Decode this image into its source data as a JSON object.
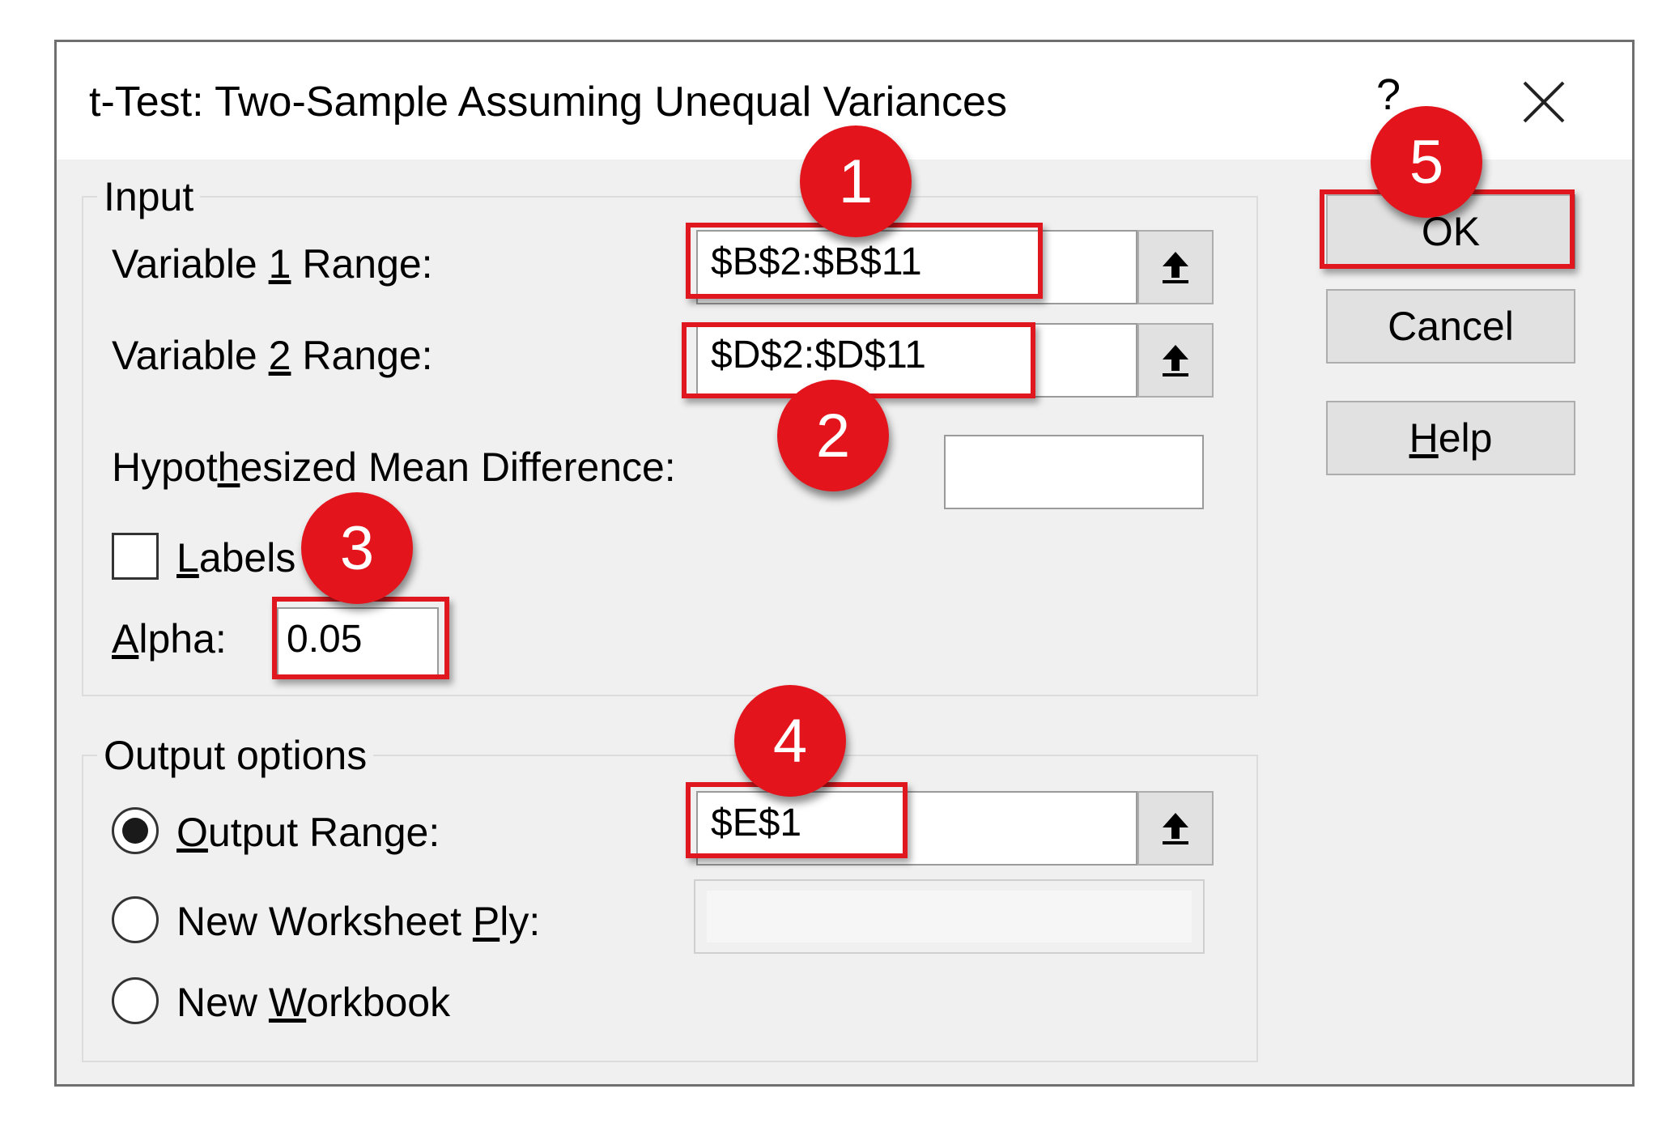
{
  "dialog": {
    "title": "t-Test: Two-Sample Assuming Unequal Variances",
    "help_glyph": "?"
  },
  "input_group": {
    "legend": "Input",
    "var1": {
      "label_pre": "Variable ",
      "label_key": "1",
      "label_post": " Range:",
      "value": "$B$2:$B$11"
    },
    "var2": {
      "label_pre": "Variable ",
      "label_key": "2",
      "label_post": " Range:",
      "value": "$D$2:$D$11"
    },
    "hyp": {
      "label_pre": "Hypot",
      "label_key": "h",
      "label_post": "esized Mean Difference:",
      "value": ""
    },
    "labels": {
      "label_key": "L",
      "label_post": "abels",
      "checked": false
    },
    "alpha": {
      "label_key": "A",
      "label_post": "lpha:",
      "value": "0.05"
    }
  },
  "output_group": {
    "legend": "Output options",
    "output_range": {
      "label_key": "O",
      "label_post": "utput Range:",
      "value": "$E$1",
      "selected": true
    },
    "new_ply": {
      "label_pre": "New Worksheet ",
      "label_key": "P",
      "label_post": "ly:",
      "value": "",
      "selected": false
    },
    "new_workbook": {
      "label_pre": "New ",
      "label_key": "W",
      "label_post": "orkbook",
      "selected": false
    }
  },
  "buttons": {
    "ok": "OK",
    "cancel": "Cancel",
    "help_key": "H",
    "help_rest": "elp"
  },
  "badges": [
    "1",
    "2",
    "3",
    "4",
    "5"
  ],
  "colors": {
    "highlight": "#e0171f",
    "badge": "#e4141c",
    "dialog_bg": "#f0f0f0"
  }
}
